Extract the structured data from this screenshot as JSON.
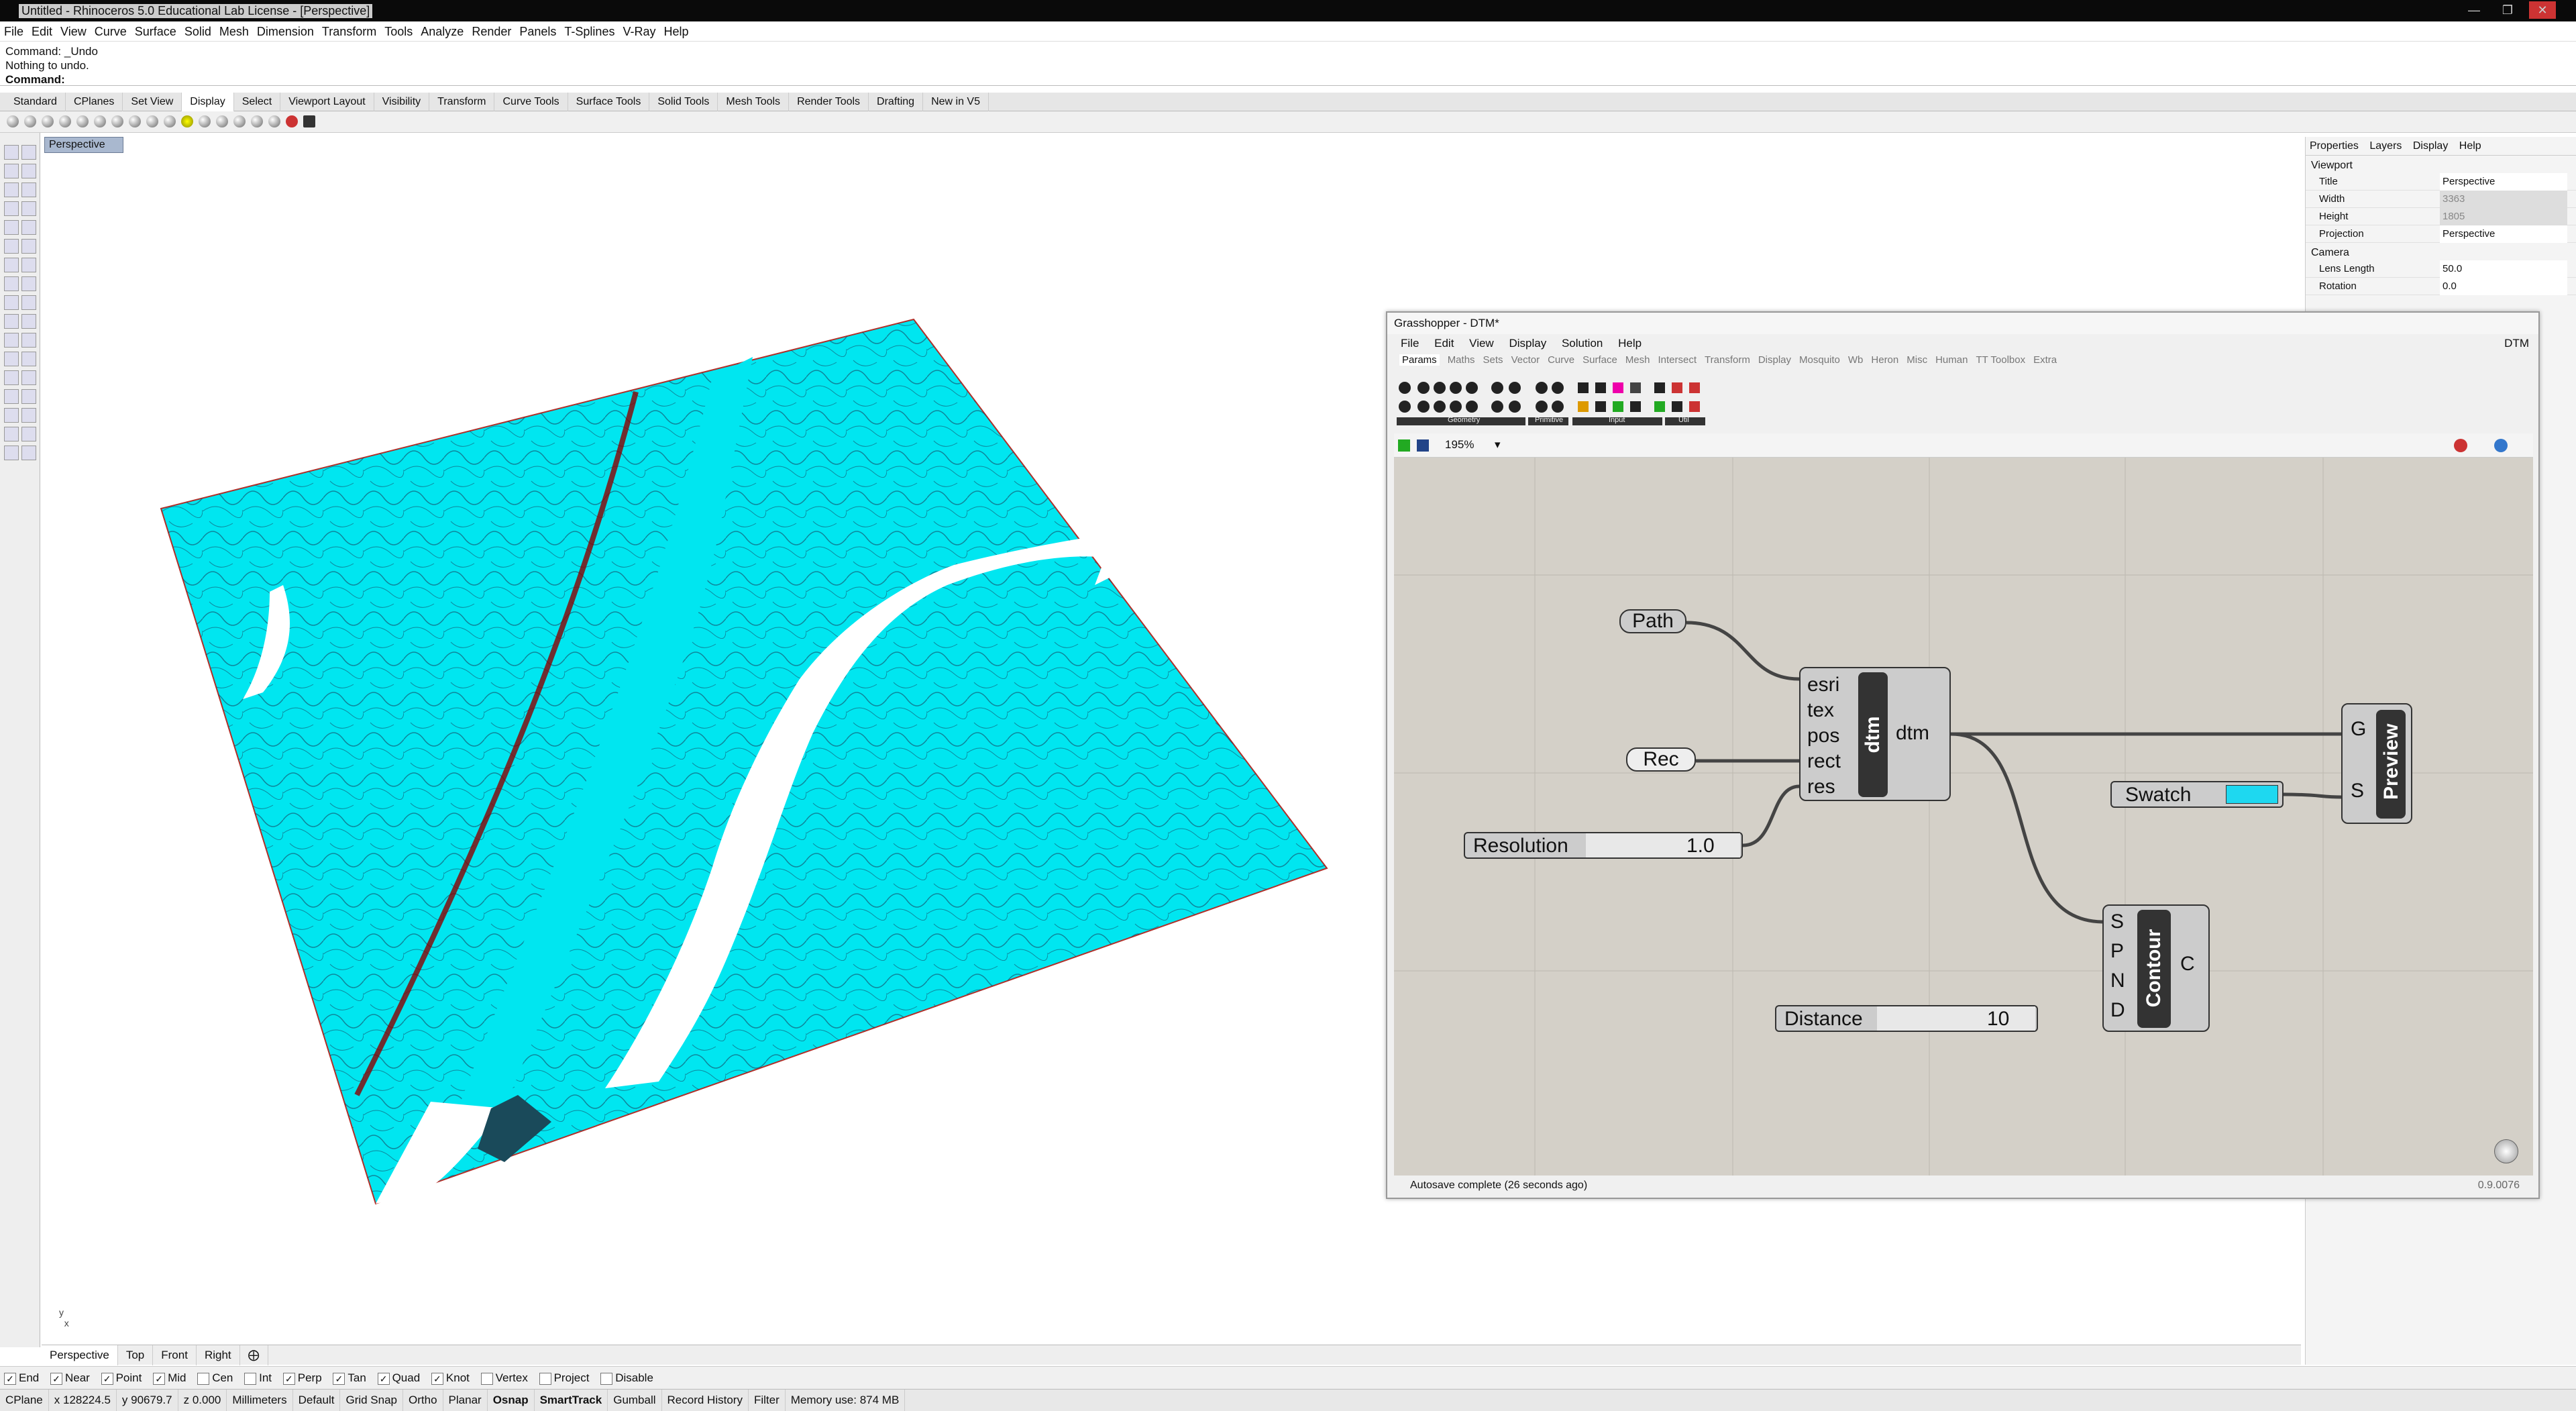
{
  "window": {
    "title": "Untitled - Rhinoceros 5.0 Educational Lab License - [Perspective]"
  },
  "menubar": [
    "File",
    "Edit",
    "View",
    "Curve",
    "Surface",
    "Solid",
    "Mesh",
    "Dimension",
    "Transform",
    "Tools",
    "Analyze",
    "Render",
    "Panels",
    "T-Splines",
    "V-Ray",
    "Help"
  ],
  "command": {
    "history": [
      "Command: _Undo",
      "Nothing to undo."
    ],
    "prompt": "Command:"
  },
  "toolbar_tabs": [
    "Standard",
    "CPlanes",
    "Set View",
    "Display",
    "Select",
    "Viewport Layout",
    "Visibility",
    "Transform",
    "Curve Tools",
    "Surface Tools",
    "Solid Tools",
    "Mesh Tools",
    "Render Tools",
    "Drafting",
    "New in V5"
  ],
  "toolbar_active_tab": "Display",
  "viewport": {
    "label": "Perspective",
    "terrain_colors": {
      "fill": "#00e6f0",
      "contour": "#1a3a58",
      "ridge": "#8b0000",
      "land": "#ffffff"
    }
  },
  "right_panel": {
    "tabs": [
      "Properties",
      "Layers",
      "Display",
      "Help"
    ],
    "section_viewport": "Viewport",
    "rows": [
      {
        "key": "Title",
        "value": "Perspective",
        "dim": false
      },
      {
        "key": "Width",
        "value": "3363",
        "dim": true
      },
      {
        "key": "Height",
        "value": "1805",
        "dim": true
      },
      {
        "key": "Projection",
        "value": "Perspective",
        "dim": false
      }
    ],
    "section_camera": "Camera",
    "camera_rows": [
      {
        "key": "Lens Length",
        "value": "50.0"
      },
      {
        "key": "Rotation",
        "value": "0.0"
      }
    ]
  },
  "grasshopper": {
    "title": "Grasshopper - DTM*",
    "doc_name": "DTM",
    "menu": [
      "File",
      "Edit",
      "View",
      "Display",
      "Solution",
      "Help"
    ],
    "component_tabs": [
      "Params",
      "Maths",
      "Sets",
      "Vector",
      "Curve",
      "Surface",
      "Mesh",
      "Intersect",
      "Transform",
      "Display",
      "Mosquito",
      "Wb",
      "Heron",
      "Misc",
      "Human",
      "TT Toolbox",
      "Extra"
    ],
    "active_tab": "Params",
    "ribbon_groups": [
      "Geometry",
      "Primitive",
      "Input",
      "Util"
    ],
    "zoom": "195%",
    "nodes": {
      "path": "Path",
      "rec": "Rec",
      "resolution_label": "Resolution",
      "resolution_value": "1.0",
      "dtm_inputs": [
        "esri",
        "tex",
        "pos",
        "rect",
        "res"
      ],
      "dtm_name": "dtm",
      "dtm_output": "dtm",
      "swatch": "Swatch",
      "swatch_color": "#1ed8f0",
      "preview_name": "Preview",
      "preview_inputs": [
        "G",
        "S"
      ],
      "contour_inputs": [
        "S",
        "P",
        "N",
        "D"
      ],
      "contour_name": "Contour",
      "contour_output": "C",
      "distance_label": "Distance",
      "distance_value": "10"
    },
    "status": "Autosave complete (26 seconds ago)",
    "version": "0.9.0076"
  },
  "bottom_tabs": [
    "Perspective",
    "Top",
    "Front",
    "Right"
  ],
  "osnap": [
    {
      "label": "End",
      "checked": true
    },
    {
      "label": "Near",
      "checked": true
    },
    {
      "label": "Point",
      "checked": true
    },
    {
      "label": "Mid",
      "checked": true
    },
    {
      "label": "Cen",
      "checked": false
    },
    {
      "label": "Int",
      "checked": false
    },
    {
      "label": "Perp",
      "checked": true
    },
    {
      "label": "Tan",
      "checked": true
    },
    {
      "label": "Quad",
      "checked": true
    },
    {
      "label": "Knot",
      "checked": true
    },
    {
      "label": "Vertex",
      "checked": false
    },
    {
      "label": "Project",
      "checked": false
    },
    {
      "label": "Disable",
      "checked": false
    }
  ],
  "statusbar": {
    "cplane": "CPlane",
    "x": "x 128224.5",
    "y": "y 90679.7",
    "z": "z 0.000",
    "units": "Millimeters",
    "layer": "Default",
    "toggles": [
      "Grid Snap",
      "Ortho",
      "Planar",
      "Osnap",
      "SmartTrack",
      "Gumball",
      "Record History",
      "Filter"
    ],
    "memory": "Memory use: 874 MB"
  }
}
